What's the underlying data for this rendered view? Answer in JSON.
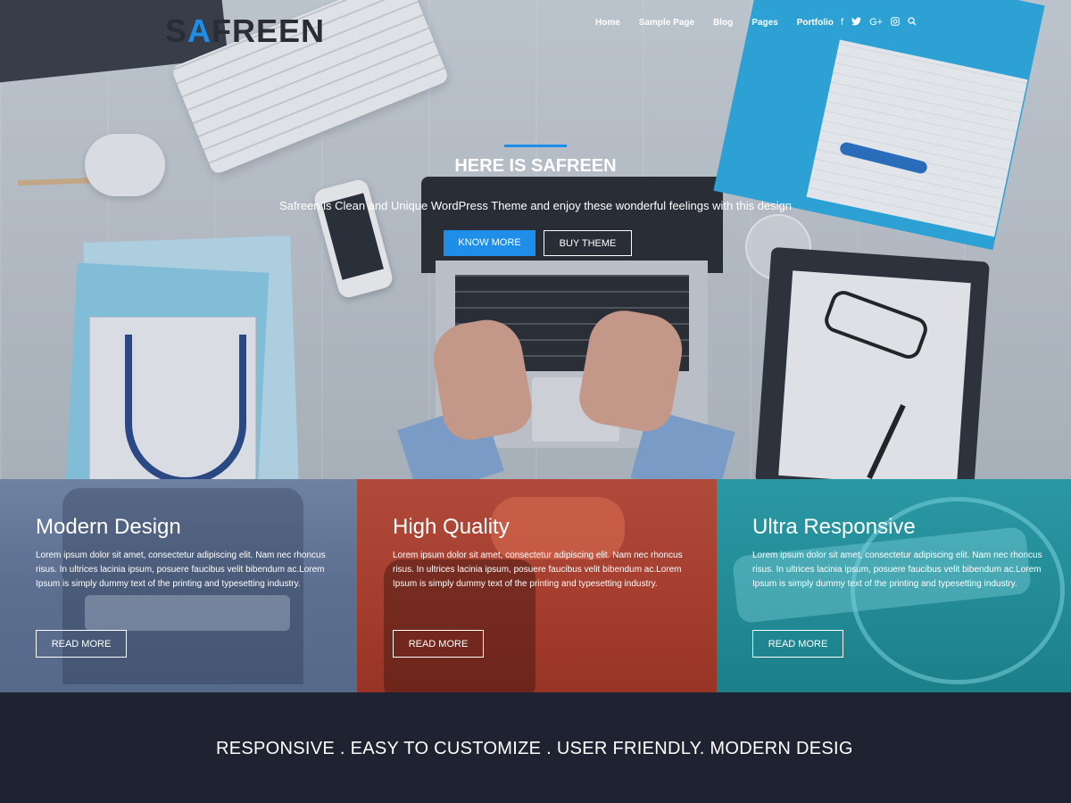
{
  "header": {
    "logo_prefix": "S",
    "logo_accent": "A",
    "logo_suffix": "FREEN",
    "nav": [
      "Home",
      "Sample Page",
      "Blog",
      "Pages",
      "Portfolio"
    ],
    "social_icons": [
      "facebook-icon",
      "twitter-icon",
      "google-plus-icon",
      "instagram-icon",
      "search-icon"
    ]
  },
  "hero": {
    "title": "HERE IS SAFREEN",
    "subtitle": "Safreen is Clean and Unique WordPress Theme and enjoy these wonderful feelings with this design",
    "primary_button": "KNOW MORE",
    "secondary_button": "BUY THEME"
  },
  "features": [
    {
      "title": "Modern Design",
      "text": "Lorem ipsum dolor sit amet, consectetur adipiscing elit. Nam nec rhoncus risus. In ultrices lacinia ipsum, posuere faucibus velit bibendum ac.Lorem Ipsum is simply dummy text of the printing and typesetting industry.",
      "button": "READ MORE"
    },
    {
      "title": "High Quality",
      "text": "Lorem ipsum dolor sit amet, consectetur adipiscing elit. Nam nec rhoncus risus. In ultrices lacinia ipsum, posuere faucibus velit bibendum ac.Lorem Ipsum is simply dummy text of the printing and typesetting industry.",
      "button": "READ MORE"
    },
    {
      "title": "Ultra Responsive",
      "text": "Lorem ipsum dolor sit amet, consectetur adipiscing elit. Nam nec rhoncus risus. In ultrices lacinia ipsum, posuere faucibus velit bibendum ac.Lorem Ipsum is simply dummy text of the printing and typesetting industry.",
      "button": "READ MORE"
    }
  ],
  "tagline": "RESPONSIVE . EASY TO CUSTOMIZE . USER FRIENDLY. MODERN DESIG",
  "colors": {
    "accent": "#1e8ee8",
    "feature_1": "#5c6f91",
    "feature_2": "#a43d2d",
    "feature_3": "#228a95",
    "footer_bg": "#1f2230"
  }
}
